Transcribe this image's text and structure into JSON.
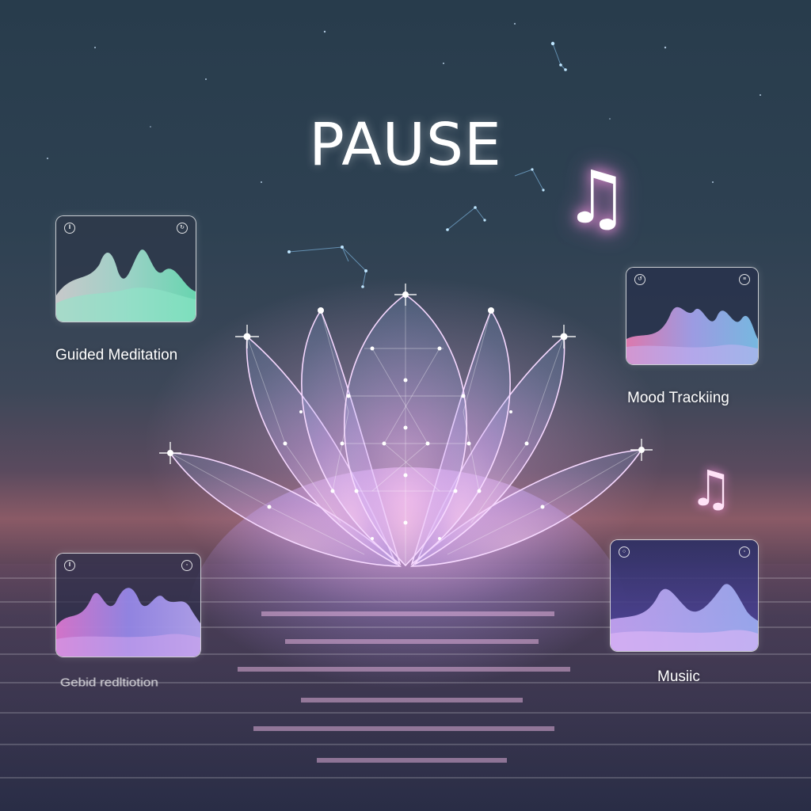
{
  "app": {
    "title": "PAUSE"
  },
  "cards": [
    {
      "id": "guided-meditation",
      "label": "Guided Meditation",
      "left_icon": "pause-icon",
      "right_icon": "options-icon"
    },
    {
      "id": "mood-tracking",
      "label": "Mood Trackiing",
      "left_icon": "replay-icon",
      "right_icon": "options-icon"
    },
    {
      "id": "reflected-meditation",
      "label": "Gebid redltiotion",
      "left_icon": "pause-icon",
      "right_icon": "options-icon"
    },
    {
      "id": "music",
      "label": "Musiic",
      "left_icon": "play-icon",
      "right_icon": "options-icon"
    }
  ],
  "decor": {
    "note_glyph": "♫",
    "icons": [
      "music-note-icon",
      "lotus-icon",
      "constellation-icon"
    ]
  },
  "colors": {
    "accent_pink": "#f3a6e6",
    "accent_teal": "#7fe3c6",
    "accent_violet": "#9b8cf0",
    "sky_top": "#283c4c",
    "horizon": "#8a5a66"
  }
}
